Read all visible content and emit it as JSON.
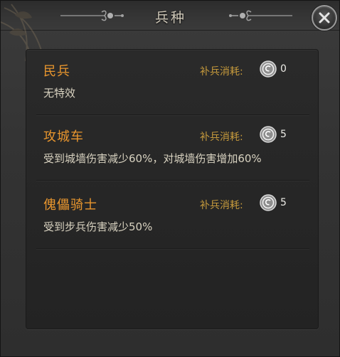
{
  "window": {
    "title": "兵种",
    "close_icon": "close-x-icon"
  },
  "troops": [
    {
      "name": "民兵",
      "description": "无特效",
      "cost_label": "补兵消耗:",
      "cost_icon": "silver-coin-icon",
      "cost_value": "0"
    },
    {
      "name": "攻城车",
      "description": "受到城墙伤害减少60%，对城墙伤害增加60%",
      "cost_label": "补兵消耗:",
      "cost_icon": "silver-coin-icon",
      "cost_value": "5"
    },
    {
      "name": "傀儡骑士",
      "description": "受到步兵伤害减少50%",
      "cost_label": "补兵消耗:",
      "cost_icon": "silver-coin-icon",
      "cost_value": "5"
    }
  ],
  "colors": {
    "troop_name": "#e9962e",
    "cost_label": "#c69a3c",
    "description": "#d8d2c0",
    "background": "#333333"
  }
}
